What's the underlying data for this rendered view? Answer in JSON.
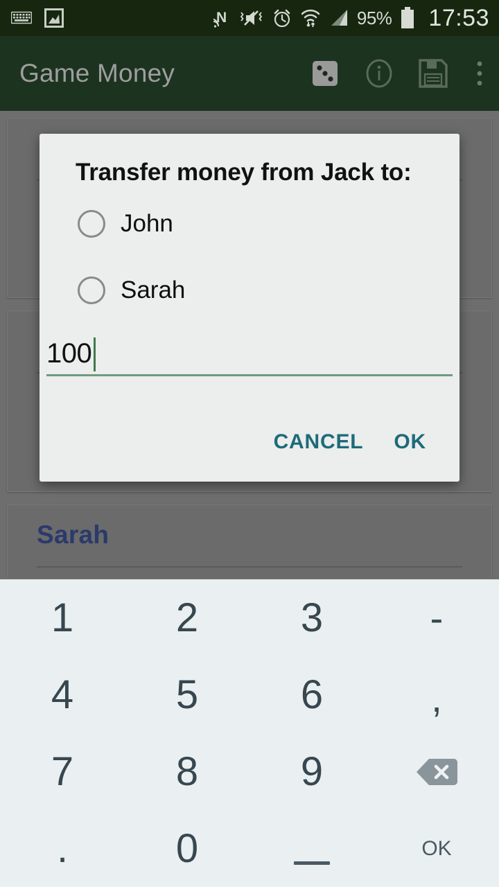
{
  "status_bar": {
    "icons": [
      "keyboard-icon",
      "screenshot-image-icon",
      "nfc-icon",
      "mute-vibrate-icon",
      "alarm-icon",
      "wifi-icon",
      "cell-signal-icon"
    ],
    "battery_percent": "95%",
    "clock": "17:53"
  },
  "app_bar": {
    "title": "Game Money",
    "actions": [
      {
        "name": "dice-icon",
        "label": "Dice"
      },
      {
        "name": "info-icon",
        "label": "Info"
      },
      {
        "name": "save-icon",
        "label": "Save"
      },
      {
        "name": "overflow-menu-icon",
        "label": "More options"
      }
    ]
  },
  "background_list": {
    "cards": [
      {
        "name": "",
        "amount": ""
      },
      {
        "name": "",
        "amount": ""
      },
      {
        "name": "Sarah",
        "amount": ""
      }
    ]
  },
  "dialog": {
    "title": "Transfer money from Jack to:",
    "options": [
      {
        "label": "John",
        "selected": false
      },
      {
        "label": "Sarah",
        "selected": false
      }
    ],
    "amount_input": {
      "value": "100",
      "placeholder": ""
    },
    "cancel_label": "CANCEL",
    "ok_label": "OK"
  },
  "keyboard": {
    "rows": [
      [
        {
          "label": "1",
          "type": "digit"
        },
        {
          "label": "2",
          "type": "digit"
        },
        {
          "label": "3",
          "type": "digit"
        },
        {
          "label": "-",
          "type": "dash"
        }
      ],
      [
        {
          "label": "4",
          "type": "digit"
        },
        {
          "label": "5",
          "type": "digit"
        },
        {
          "label": "6",
          "type": "digit"
        },
        {
          "label": ",",
          "type": "comma"
        }
      ],
      [
        {
          "label": "7",
          "type": "digit"
        },
        {
          "label": "8",
          "type": "digit"
        },
        {
          "label": "9",
          "type": "digit"
        },
        {
          "label": "",
          "type": "backspace"
        }
      ],
      [
        {
          "label": ".",
          "type": "dot"
        },
        {
          "label": "0",
          "type": "digit"
        },
        {
          "label": "",
          "type": "space"
        },
        {
          "label": "OK",
          "type": "enter"
        }
      ]
    ]
  },
  "colors": {
    "status_bar": "#16260f",
    "app_bar": "#1c3320",
    "scrim": "#6e6e6e",
    "dialog_bg": "#eceded",
    "accent_teal": "#1d6b78",
    "underline_green": "#6f9a7c",
    "card_name": "#2b3a6b",
    "keyboard_bg": "#eaeff2",
    "key_text": "#37474f"
  }
}
